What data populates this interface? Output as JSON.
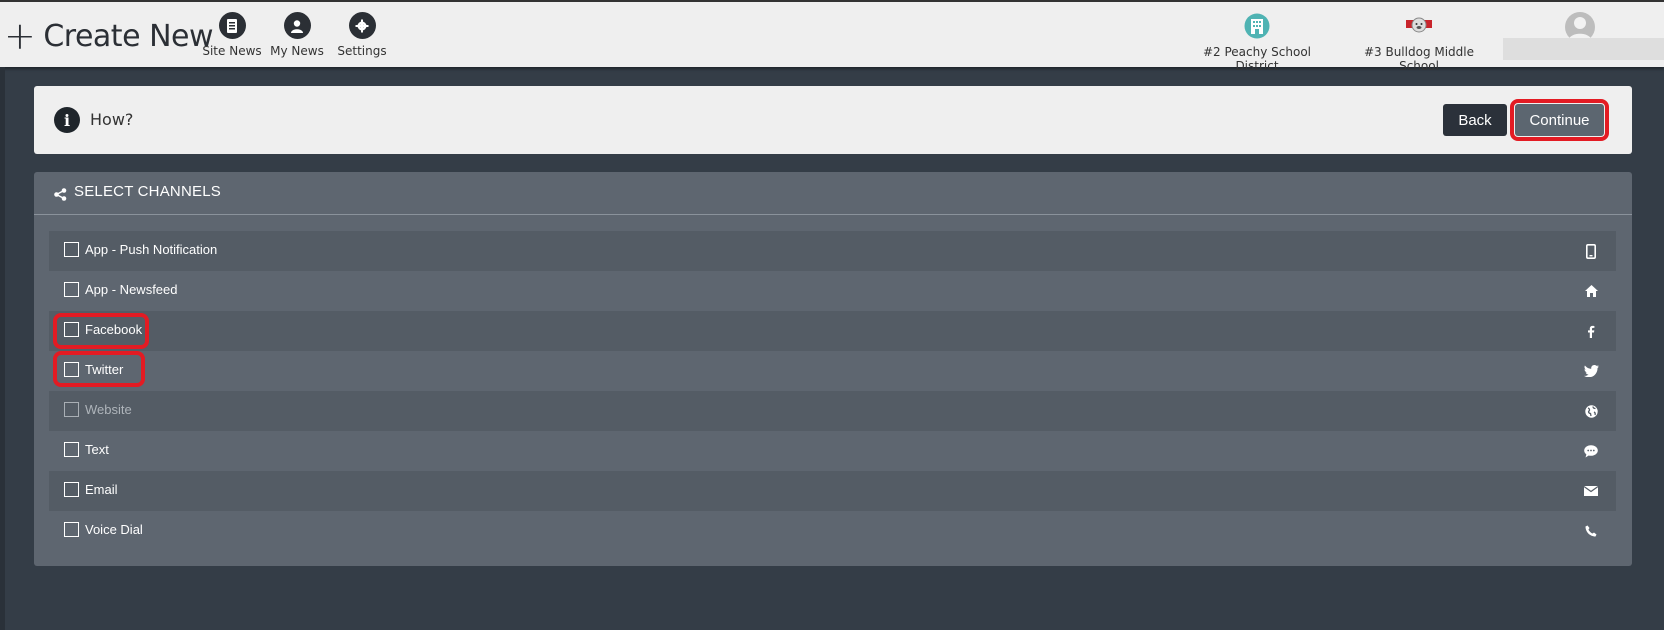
{
  "header": {
    "create_new_label": "Create New",
    "nav": [
      {
        "label": "Site News",
        "icon": "document-icon"
      },
      {
        "label": "My News",
        "icon": "user-icon"
      },
      {
        "label": "Settings",
        "icon": "gear-icon"
      }
    ],
    "schools": [
      {
        "label": "#2 Peachy School District",
        "icon": "district-logo-icon"
      },
      {
        "label": "#3 Bulldog Middle School",
        "icon": "bulldog-logo-icon"
      }
    ]
  },
  "how_panel": {
    "label": "How?",
    "back_label": "Back",
    "continue_label": "Continue"
  },
  "channels": {
    "title": "SELECT CHANNELS",
    "items": [
      {
        "label": "App - Push Notification",
        "icon": "mobile-icon",
        "enabled": true
      },
      {
        "label": "App - Newsfeed",
        "icon": "home-icon",
        "enabled": true
      },
      {
        "label": "Facebook",
        "icon": "facebook-icon",
        "enabled": true
      },
      {
        "label": "Twitter",
        "icon": "twitter-icon",
        "enabled": true
      },
      {
        "label": "Website",
        "icon": "globe-icon",
        "enabled": false
      },
      {
        "label": "Text",
        "icon": "chat-icon",
        "enabled": true
      },
      {
        "label": "Email",
        "icon": "envelope-icon",
        "enabled": true
      },
      {
        "label": "Voice Dial",
        "icon": "phone-icon",
        "enabled": true
      }
    ]
  },
  "colors": {
    "highlight": "#e31b23",
    "panel_bg": "#5e6670",
    "page_bg": "#343d47"
  }
}
